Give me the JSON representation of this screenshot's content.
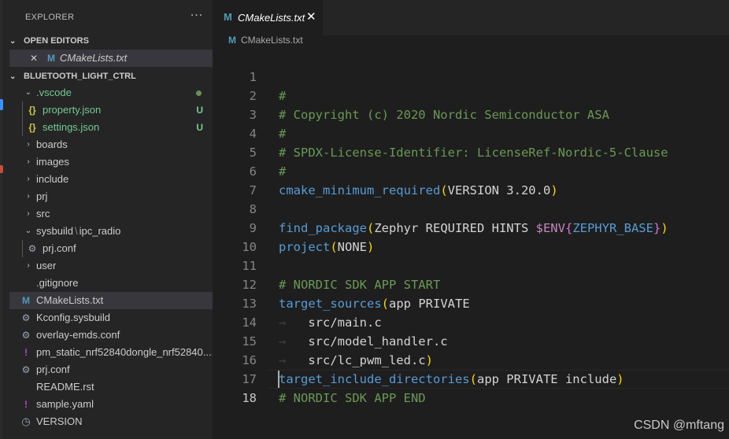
{
  "sidebar": {
    "title": "EXPLORER",
    "more_label": "···",
    "open_editors": {
      "header": "OPEN EDITORS",
      "items": [
        {
          "close": "✕",
          "icon": "M",
          "label": "CMakeLists.txt"
        }
      ]
    },
    "project": {
      "header": "BLUETOOTH_LIGHT_CTRL",
      "items": [
        {
          "type": "folder",
          "label": ".vscode",
          "expanded": true
        },
        {
          "type": "file",
          "icon": "{}",
          "label": "property.json",
          "badge": "U"
        },
        {
          "type": "file",
          "icon": "{}",
          "label": "settings.json",
          "badge": "U"
        },
        {
          "type": "folder",
          "label": "boards"
        },
        {
          "type": "folder",
          "label": "images"
        },
        {
          "type": "folder",
          "label": "include"
        },
        {
          "type": "folder",
          "label": "prj"
        },
        {
          "type": "folder",
          "label": "src"
        },
        {
          "type": "folder",
          "label": "sysbuild",
          "label2": "ipc_radio",
          "expanded": true
        },
        {
          "type": "file",
          "icon": "gear",
          "label": "prj.conf"
        },
        {
          "type": "folder",
          "label": "user"
        },
        {
          "type": "file",
          "icon": "none",
          "label": ".gitignore"
        },
        {
          "type": "file",
          "icon": "M",
          "label": "CMakeLists.txt"
        },
        {
          "type": "file",
          "icon": "gear",
          "label": "Kconfig.sysbuild"
        },
        {
          "type": "file",
          "icon": "gear",
          "label": "overlay-emds.conf"
        },
        {
          "type": "file",
          "icon": "!",
          "label": "pm_static_nrf52840dongle_nrf52840...."
        },
        {
          "type": "file",
          "icon": "gear",
          "label": "prj.conf"
        },
        {
          "type": "file",
          "icon": "none",
          "label": "README.rst"
        },
        {
          "type": "file",
          "icon": "!",
          "label": "sample.yaml"
        },
        {
          "type": "file",
          "icon": "clock",
          "label": "VERSION"
        }
      ]
    }
  },
  "editor": {
    "tab": {
      "icon": "M",
      "label": "CMakeLists.txt",
      "close": "✕"
    },
    "breadcrumb": {
      "icon": "M",
      "label": "CMakeLists.txt"
    },
    "lines": [
      {
        "n": "1",
        "text": "#"
      },
      {
        "n": "2",
        "text": "# Copyright (c) 2020 Nordic Semiconductor ASA"
      },
      {
        "n": "3",
        "text": "#"
      },
      {
        "n": "4",
        "text": "# SPDX-License-Identifier: LicenseRef-Nordic-5-Clause"
      },
      {
        "n": "5",
        "text": "#"
      },
      {
        "n": "6",
        "func": "cmake_minimum_required",
        "args": "VERSION 3.20.0"
      },
      {
        "n": "7",
        "text": ""
      },
      {
        "n": "8",
        "func": "find_package",
        "args": "Zephyr REQUIRED HINTS ",
        "var": "$ENV",
        "varinner": "ZEPHYR_BASE"
      },
      {
        "n": "9",
        "func": "project",
        "args": "NONE"
      },
      {
        "n": "10",
        "text": ""
      },
      {
        "n": "11",
        "text": "# NORDIC SDK APP START"
      },
      {
        "n": "12",
        "func": "target_sources",
        "args": "app PRIVATE"
      },
      {
        "n": "13",
        "indent": "src/main.c"
      },
      {
        "n": "14",
        "indent": "src/model_handler.c"
      },
      {
        "n": "15",
        "indent": "src/lc_pwm_led.c",
        "close": ")"
      },
      {
        "n": "16",
        "func": "target_include_directories",
        "args": "app PRIVATE include"
      },
      {
        "n": "17",
        "text": "# NORDIC SDK APP END"
      },
      {
        "n": "18",
        "text": ""
      }
    ]
  },
  "watermark": "CSDN @mftang",
  "colors": {
    "sidebar_bg": "#252526",
    "editor_bg": "#1e1e1e",
    "comment": "#6a9955",
    "keyword": "#569cd6",
    "paren": "#ffd700",
    "untracked": "#73c991",
    "cmake_icon": "#519aba"
  }
}
